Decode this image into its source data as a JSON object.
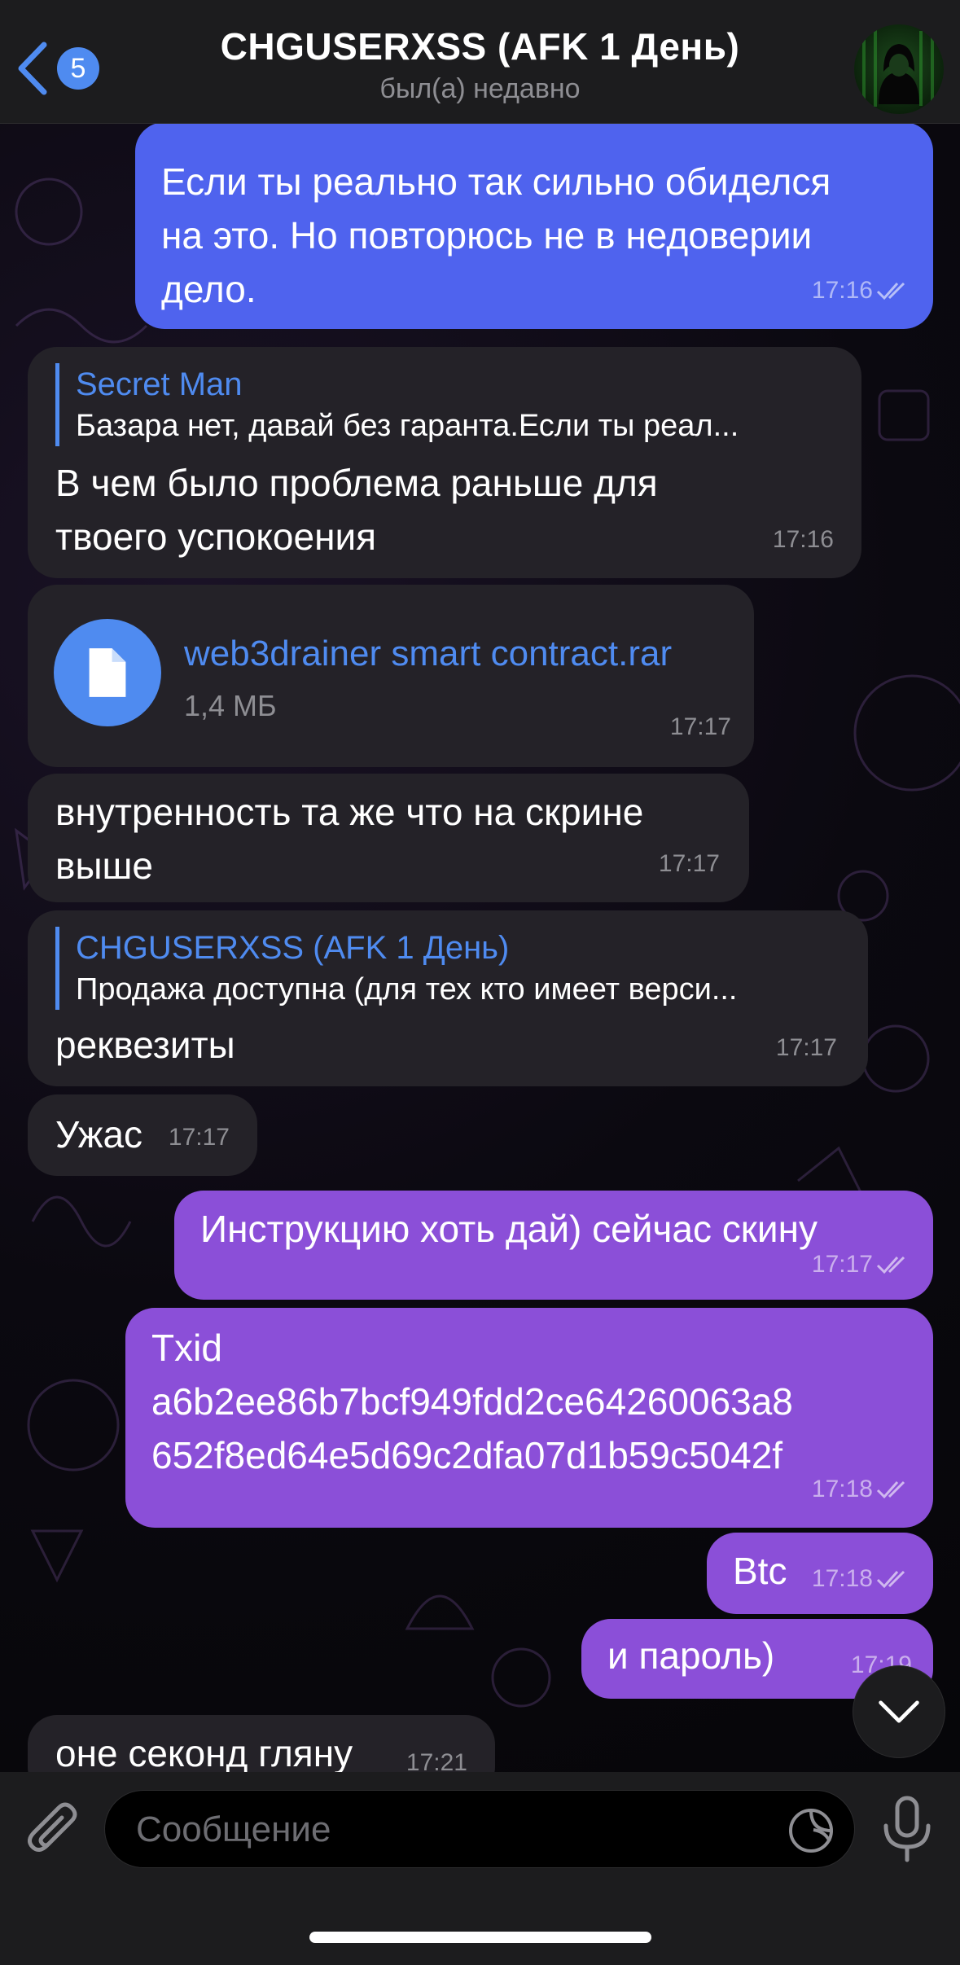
{
  "header": {
    "back_count": "5",
    "title": "CHGUSERXSS (AFK 1 День)",
    "subtitle": "был(а) недавно"
  },
  "messages": [
    {
      "type": "outgoing",
      "text_lines": [
        "Если ты реально так сильно обиделся",
        "на это. Но повторюсь не в недоверии",
        "дело."
      ],
      "time": "17:16"
    },
    {
      "type": "incoming",
      "reply_name": "Secret Man",
      "reply_text": "Базара нет, давай без гаранта.Если ты реал...",
      "text_lines": [
        "В чем было проблема раньше для",
        "твоего успокоения"
      ],
      "time": "17:16"
    },
    {
      "type": "incoming-file",
      "file_name": "web3drainer smart contract.rar",
      "file_size": "1,4 МБ",
      "time": "17:17"
    },
    {
      "type": "incoming",
      "text_lines": [
        "внутренность та же что на скрине",
        "выше"
      ],
      "time": "17:17"
    },
    {
      "type": "incoming",
      "reply_name": "CHGUSERXSS (AFK 1 День)",
      "reply_text": "Продажа доступна (для тех кто имеет верси...",
      "text_lines": [
        "реквезиты"
      ],
      "time": "17:17"
    },
    {
      "type": "incoming",
      "text_lines": [
        "Ужас"
      ],
      "time": "17:17"
    },
    {
      "type": "outgoing",
      "text_lines": [
        "Инструкцию хоть дай) сейчас скину"
      ],
      "time": "17:17"
    },
    {
      "type": "outgoing",
      "text_lines": [
        "Txid",
        "a6b2ee86b7bcf949fdd2ce64260063a8",
        "652f8ed64e5d69c2dfa07d1b59c5042f"
      ],
      "time": "17:18"
    },
    {
      "type": "outgoing",
      "text_lines": [
        "Btc"
      ],
      "time": "17:18"
    },
    {
      "type": "outgoing",
      "text_lines": [
        "и пароль)"
      ],
      "time": "17:19"
    },
    {
      "type": "incoming",
      "text_lines": [
        "оне секонд гляну"
      ],
      "time": "17:21"
    }
  ],
  "input": {
    "placeholder": "Сообщение"
  },
  "icons": {
    "back": "chevron-left-icon",
    "attach": "paperclip-icon",
    "sticker": "sticker-icon",
    "mic": "microphone-icon",
    "scroll": "chevron-down-icon",
    "file": "document-icon",
    "read": "double-check-icon"
  },
  "colors": {
    "outgoing_blue": "#4f63ee",
    "outgoing_purple": "#8b4fd8",
    "incoming": "#242228",
    "accent": "#4f8bf0"
  }
}
